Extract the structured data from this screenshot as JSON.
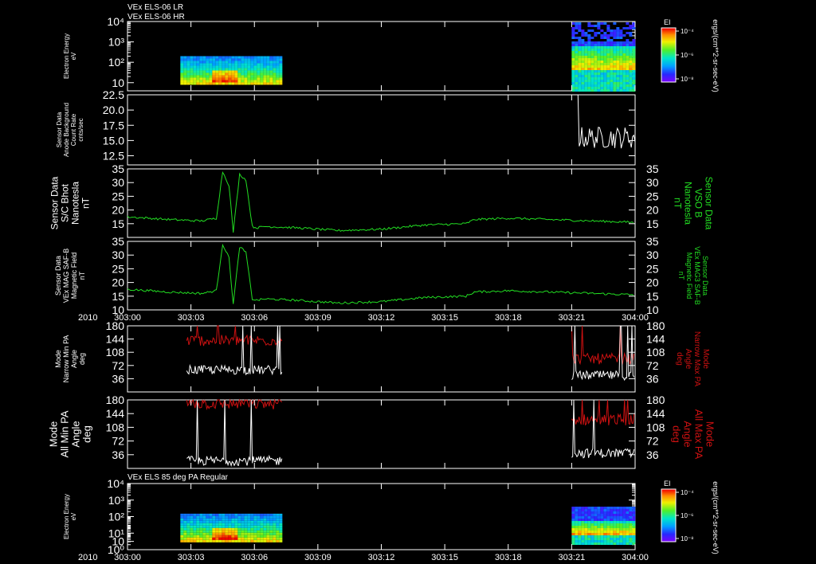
{
  "header": {
    "line1": "VEx ELS-06 LR",
    "line2": "VEx ELS-06 HR",
    "bottom_panel_title": "VEx ELS 85 deg PA Regular"
  },
  "colors": {
    "background": "#000000",
    "axis": "#ffffff",
    "green": "#22dd22",
    "red": "#cc1111",
    "white": "#ffffff"
  },
  "time_axis": {
    "year_label": "2010",
    "ticks": [
      "303:00",
      "303:03",
      "303:06",
      "303:09",
      "303:12",
      "303:15",
      "303:18",
      "303:21",
      "304:00"
    ]
  },
  "colorbar": {
    "title": "EI",
    "ticks": [
      "10⁻⁴",
      "10⁻⁶",
      "10⁻⁸"
    ],
    "unit_label_top": "ergs/(cm**2-sr-sec-eV)",
    "unit_label_bottom": "ergs/(cm**2-sr-sec-eV)"
  },
  "chart_data": [
    {
      "type": "heatmap",
      "ylabel_lines": [
        "Electron Energy",
        "eV"
      ],
      "y_scale": "log",
      "y_tick_labels": [
        "10",
        "10²",
        "10³",
        "10⁴"
      ],
      "data_blocks": [
        {
          "start": "303:02.5",
          "end": "303:07.3",
          "energy_range_eV": [
            8,
            200
          ]
        },
        {
          "start": "303:21.0",
          "end": "304:00",
          "energy_range_eV": [
            3,
            20000
          ]
        }
      ]
    },
    {
      "type": "line",
      "ylabel_lines": [
        "Sensor Data",
        "Anode Background",
        "Count Rate",
        "cnts/sec"
      ],
      "ylim": [
        11.0,
        22.5
      ],
      "y_tick_labels": [
        "12.5",
        "15.0",
        "17.5",
        "20.0",
        "22.5"
      ],
      "series": [
        {
          "color": "white",
          "x_range_min": [
            21.0,
            24.0
          ],
          "y_mean": 15.5,
          "y_jitter": 1.8
        }
      ]
    },
    {
      "type": "line",
      "ylabel_lines": [
        "Sensor Data",
        "S/C Bhot",
        "Nanotesla",
        "nT"
      ],
      "right_ylabel_lines": [
        "Sensor Data",
        "VSO B",
        "Nanotesla",
        "nT"
      ],
      "ylim": [
        10,
        35
      ],
      "y_tick_labels": [
        "15",
        "20",
        "25",
        "30",
        "35"
      ],
      "series": [
        {
          "color": "green",
          "x_min": [
            0,
            2,
            3.5,
            4.2,
            4.5,
            4.8,
            5.0,
            5.3,
            5.6,
            5.9,
            6.1,
            6.5,
            8,
            10,
            12,
            14,
            16,
            16.4,
            18,
            20,
            22,
            24
          ],
          "y": [
            17.5,
            16.5,
            16,
            17,
            34,
            29,
            12,
            33,
            31,
            14,
            13.5,
            14,
            13.5,
            12.5,
            13,
            14.5,
            15,
            16.5,
            17,
            16.5,
            16,
            15.5
          ]
        }
      ]
    },
    {
      "type": "line",
      "ylabel_lines": [
        "Sensor Data",
        "VEx MAG SAF-B",
        "Magnetic Field",
        "nT"
      ],
      "right_ylabel_lines": [
        "Sensor Data",
        "VEx MAG3 SAF-B",
        "Magnetic Field",
        "nT"
      ],
      "ylim": [
        10,
        35
      ],
      "y_tick_labels": [
        "10",
        "15",
        "20",
        "25",
        "30",
        "35"
      ],
      "series": [
        {
          "color": "green",
          "x_min": [
            0,
            2,
            3.5,
            4.2,
            4.5,
            4.8,
            5.0,
            5.3,
            5.6,
            5.9,
            6.1,
            6.5,
            8,
            10,
            12,
            14,
            16,
            16.4,
            18,
            20,
            22,
            24
          ],
          "y": [
            17.5,
            16.5,
            16,
            17,
            34,
            29,
            12,
            33,
            31,
            14,
            13.5,
            14,
            13.5,
            12.5,
            13,
            14.5,
            15,
            16.5,
            17,
            16.5,
            16,
            15.5
          ]
        }
      ]
    },
    {
      "type": "line",
      "ylabel_lines": [
        "Mode",
        "Narrow Min PA",
        "Angle",
        "deg"
      ],
      "right_ylabel_lines": [
        "Mode",
        "Narrow Max PA",
        "Angle",
        "deg"
      ],
      "ylim": [
        0,
        180
      ],
      "y_tick_labels": [
        "36",
        "72",
        "108",
        "144",
        "180"
      ],
      "series": [
        {
          "color": "red",
          "block1_level": 140,
          "block2_level": 90
        },
        {
          "color": "white",
          "block1_level": 60,
          "block2_level": 45
        }
      ]
    },
    {
      "type": "line",
      "ylabel_lines": [
        "Mode",
        "All Min PA",
        "Angle",
        "deg"
      ],
      "right_ylabel_lines": [
        "Mode",
        "All Max PA",
        "Angle",
        "deg"
      ],
      "ylim": [
        0,
        180
      ],
      "y_tick_labels": [
        "36",
        "72",
        "108",
        "144",
        "180"
      ],
      "series": [
        {
          "color": "red",
          "block1_level": 170,
          "block2_level": 128
        },
        {
          "color": "white",
          "block1_level": 20,
          "block2_level": 40
        }
      ]
    },
    {
      "type": "heatmap",
      "ylabel_lines": [
        "Electron Energy",
        "eV"
      ],
      "y_scale": "log",
      "y_tick_labels": [
        "10⁰",
        "10",
        "10¹",
        "10²",
        "10³",
        "10⁴"
      ],
      "data_blocks": [
        {
          "start": "303:02.5",
          "end": "303:07.3",
          "energy_range_eV": [
            3,
            150
          ]
        },
        {
          "start": "303:21.0",
          "end": "304:00",
          "energy_range_eV": [
            2,
            400
          ]
        }
      ]
    }
  ]
}
